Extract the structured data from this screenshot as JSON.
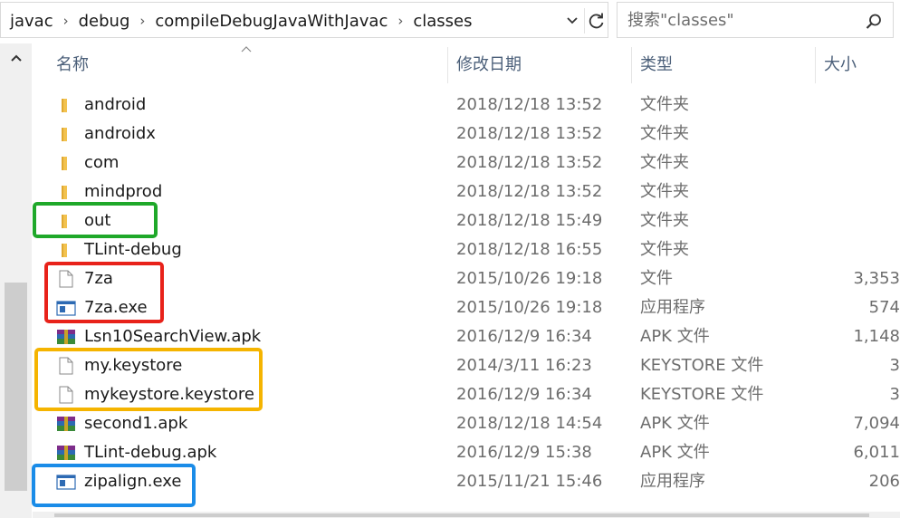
{
  "address_bar": {
    "crumbs": [
      "javac",
      "debug",
      "compileDebugJavaWithJavac",
      "classes"
    ],
    "separator": "›"
  },
  "search": {
    "placeholder": "搜索\"classes\""
  },
  "columns": {
    "name": "名称",
    "date": "修改日期",
    "type": "类型",
    "size": "大小"
  },
  "files": [
    {
      "icon": "folder-icon",
      "name": "android",
      "date": "2018/12/18 13:52",
      "type": "文件夹",
      "size": ""
    },
    {
      "icon": "folder-icon",
      "name": "androidx",
      "date": "2018/12/18 13:52",
      "type": "文件夹",
      "size": ""
    },
    {
      "icon": "folder-icon",
      "name": "com",
      "date": "2018/12/18 13:52",
      "type": "文件夹",
      "size": ""
    },
    {
      "icon": "folder-icon",
      "name": "mindprod",
      "date": "2018/12/18 13:52",
      "type": "文件夹",
      "size": ""
    },
    {
      "icon": "folder-icon",
      "name": "out",
      "date": "2018/12/18 15:49",
      "type": "文件夹",
      "size": ""
    },
    {
      "icon": "folder-icon",
      "name": "TLint-debug",
      "date": "2018/12/18 16:55",
      "type": "文件夹",
      "size": ""
    },
    {
      "icon": "blank-file-icon",
      "name": "7za",
      "date": "2015/10/26 19:18",
      "type": "文件",
      "size": "3,353"
    },
    {
      "icon": "exe-icon",
      "name": "7za.exe",
      "date": "2015/10/26 19:18",
      "type": "应用程序",
      "size": "574"
    },
    {
      "icon": "archive-icon",
      "name": "Lsn10SearchView.apk",
      "date": "2016/12/9 16:34",
      "type": "APK 文件",
      "size": "1,148"
    },
    {
      "icon": "blank-file-icon",
      "name": "my.keystore",
      "date": "2014/3/11 16:23",
      "type": "KEYSTORE 文件",
      "size": "3"
    },
    {
      "icon": "blank-file-icon",
      "name": "mykeystore.keystore",
      "date": "2016/12/9 16:34",
      "type": "KEYSTORE 文件",
      "size": "3"
    },
    {
      "icon": "archive-icon",
      "name": "second1.apk",
      "date": "2018/12/18 14:54",
      "type": "APK 文件",
      "size": "7,094"
    },
    {
      "icon": "archive-icon",
      "name": "TLint-debug.apk",
      "date": "2016/12/9 15:38",
      "type": "APK 文件",
      "size": "6,011"
    },
    {
      "icon": "exe-icon",
      "name": "zipalign.exe",
      "date": "2015/11/21 15:46",
      "type": "应用程序",
      "size": "206"
    }
  ],
  "annotation_colors": {
    "green": "#1fa82a",
    "red": "#e8221a",
    "yellow": "#f5b400",
    "blue": "#1a8ce8"
  }
}
